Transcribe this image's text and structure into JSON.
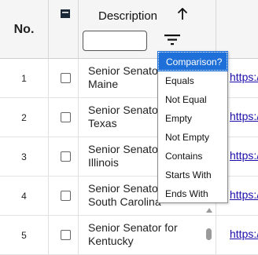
{
  "header": {
    "no_label": "No.",
    "description_label": "Description",
    "sort_icon": "arrow-up-icon",
    "filter_value": "",
    "filter_icon": "filter-icon"
  },
  "rows": [
    {
      "no": "1",
      "description": "Senior Senator for\nMaine",
      "link": "https://"
    },
    {
      "no": "2",
      "description": "Senior Senator for\nTexas",
      "link": "https://"
    },
    {
      "no": "3",
      "description": "Senior Senator for\nIllinois",
      "link": "https://"
    },
    {
      "no": "4",
      "description": "Senior Senator for\nSouth Carolina",
      "link": "https://"
    },
    {
      "no": "5",
      "description": "Senior Senator for\nKentucky",
      "link": "https://"
    }
  ],
  "filter_menu": {
    "options": [
      "Comparison?",
      "Equals",
      "Not Equal",
      "Empty",
      "Not Empty",
      "Contains",
      "Starts With",
      "Ends With"
    ],
    "selected": "Comparison?"
  },
  "colors": {
    "menu_selected_bg": "#1e6fd8",
    "link": "#1a0dab",
    "header_bg": "#f5f5f5"
  }
}
